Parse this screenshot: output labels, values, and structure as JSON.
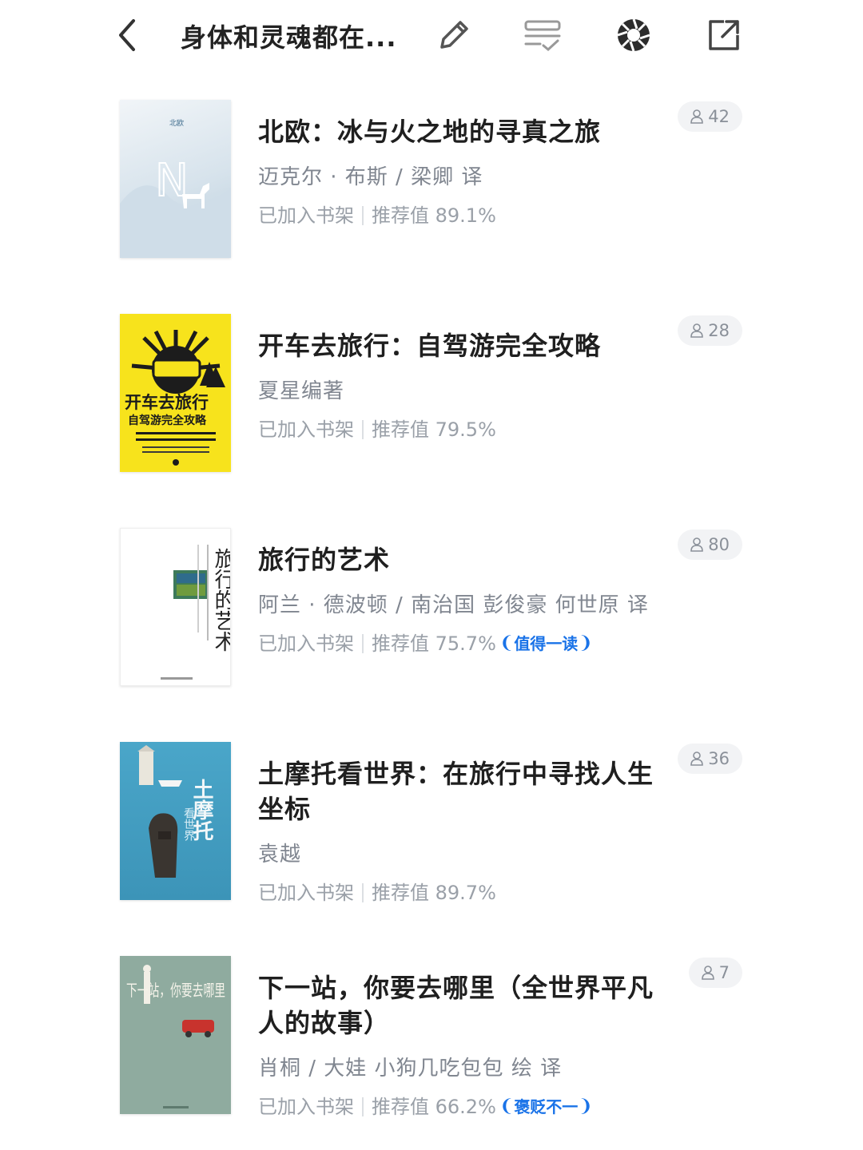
{
  "header": {
    "back_icon": "chevron-left-icon",
    "title": "身体和灵魂都在...",
    "edit_icon": "pencil-icon",
    "batch_icon": "batch-select-icon",
    "shutter_icon": "aperture-icon",
    "share_icon": "share-external-icon"
  },
  "books": [
    {
      "title": "北欧：冰与火之地的寻真之旅",
      "author": "迈克尔 · 布斯 / 梁卿 译",
      "shelf": "已加入书架",
      "score": "推荐值 89.1%",
      "badge": "",
      "readers": "42",
      "cover": {
        "text": "北欧",
        "letter": "N",
        "bg": "#dfe8ef"
      }
    },
    {
      "title": "开车去旅行：自驾游完全攻略",
      "author": "夏星编著",
      "shelf": "已加入书架",
      "score": "推荐值 79.5%",
      "badge": "",
      "readers": "28",
      "cover": {
        "text": "开车去旅行",
        "subtext": "自驾游完全攻略",
        "bg": "#f7e31c"
      }
    },
    {
      "title": "旅行的艺术",
      "author": "阿兰 · 德波顿 / 南治国 彭俊豪 何世原 译",
      "shelf": "已加入书架",
      "score": "推荐值 75.7%",
      "badge": "值得一读",
      "readers": "80",
      "cover": {
        "text": "旅行的艺术",
        "bg": "#ffffff"
      }
    },
    {
      "title": "土摩托看世界：在旅行中寻找人生坐标",
      "author": "袁越",
      "shelf": "已加入书架",
      "score": "推荐值 89.7%",
      "badge": "",
      "readers": "36",
      "cover": {
        "text": "土摩托",
        "subtext": "看世界",
        "bg": "#3f9dc2"
      }
    },
    {
      "title": "下一站，你要去哪里（全世界平凡人的故事）",
      "author": "肖桐 / 大娃 小狗几吃包包 绘 译",
      "shelf": "已加入书架",
      "score": "推荐值 66.2%",
      "badge": "褒贬不一",
      "readers": "7",
      "cover": {
        "text": "下一站，你要去哪里",
        "bg": "#8fab9f"
      }
    }
  ],
  "colors": {
    "accent": "#1a73e8",
    "muted_text": "#9aa0a8",
    "chip_bg": "#f2f3f5"
  }
}
